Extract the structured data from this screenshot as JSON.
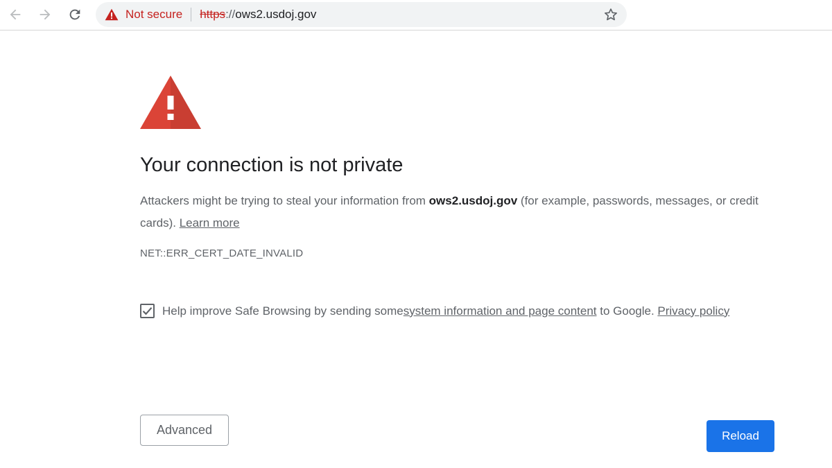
{
  "browser": {
    "security_chip": {
      "label": "Not secure",
      "icon": "warning-triangle-icon",
      "color": "#c5221f"
    },
    "url": {
      "scheme": "https",
      "separator": "://",
      "host": "ows2.usdoj.gov"
    },
    "nav_icons": [
      "back-arrow-icon",
      "forward-arrow-icon",
      "reload-icon"
    ],
    "bookmark_icon": "star-outline-icon"
  },
  "interstitial": {
    "icon": "red-warning-triangle-icon",
    "icon_color": "#db4437",
    "heading": "Your connection is not private",
    "explanation_prefix": "Attackers might be trying to steal your information from ",
    "explanation_host": "ows2.usdoj.gov",
    "explanation_suffix": " (for example, passwords, messages, or credit cards). ",
    "learn_more": "Learn more",
    "error_code": "NET::ERR_CERT_DATE_INVALID",
    "opt_in": {
      "checked": true,
      "prefix": "Help improve Safe Browsing by sending some ",
      "link": "system information and page content",
      "middle": " to Google. ",
      "privacy_link": "Privacy policy"
    },
    "buttons": {
      "advanced": "Advanced",
      "reload": "Reload",
      "reload_color": "#1a73e8"
    }
  }
}
